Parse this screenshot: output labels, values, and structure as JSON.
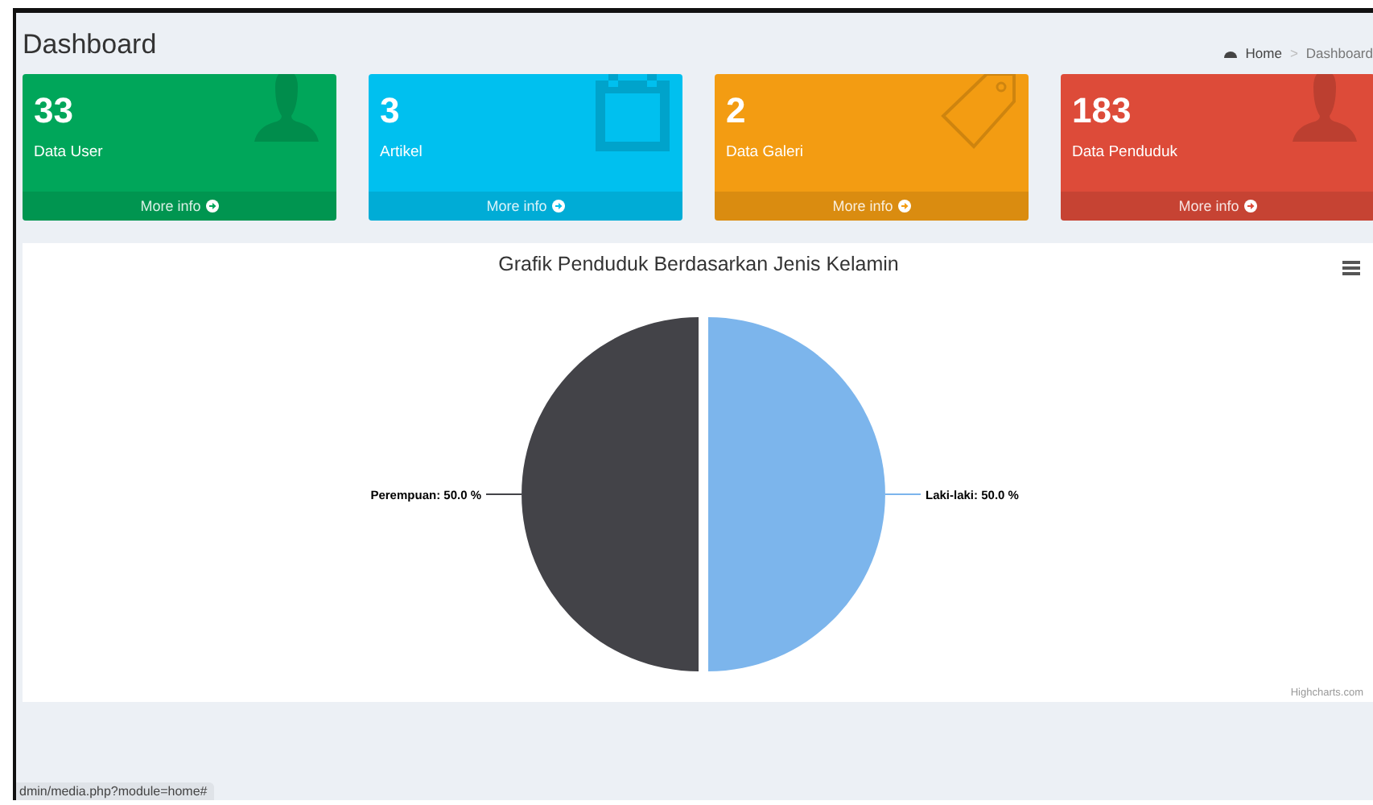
{
  "header": {
    "title": "Dashboard",
    "breadcrumb": [
      {
        "label": "Home",
        "selected": false
      },
      {
        "label": "Dashboard",
        "selected": true
      }
    ],
    "separator": ">"
  },
  "stat_boxes": [
    {
      "count": "33",
      "label": "Data User",
      "link": "More info",
      "color": "#00a65a"
    },
    {
      "count": "3",
      "label": "Artikel",
      "link": "More info",
      "color": "#00c0ef"
    },
    {
      "count": "2",
      "label": "Data Galeri",
      "link": "More info",
      "color": "#f39c12"
    },
    {
      "count": "183",
      "label": "Data Penduduk",
      "link": "More info",
      "color": "#dd4b39"
    }
  ],
  "chart_panel": {
    "credit": "Highcharts.com",
    "chart_data": {
      "type": "pie",
      "title": "Grafik Penduduk Berdasarkan Jenis Kelamin",
      "values": [
        50,
        50
      ],
      "colors": [
        "#7cb5ec",
        "#434348"
      ],
      "value_labels": [
        "Laki-laki: 50.0 %",
        "Perempuan: 50.0 %"
      ]
    }
  },
  "status_bar": {
    "url": "dmin/media.php?module=home#"
  }
}
